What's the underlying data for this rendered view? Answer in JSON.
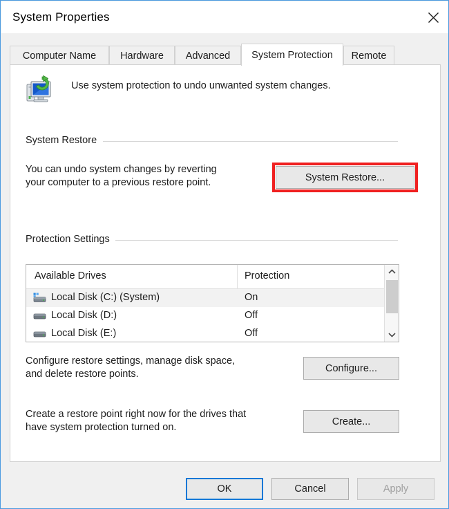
{
  "window": {
    "title": "System Properties",
    "close_icon": "close-icon",
    "border_color": "#4a9ae0"
  },
  "tabs": [
    {
      "label": "Computer Name",
      "active": false
    },
    {
      "label": "Hardware",
      "active": false
    },
    {
      "label": "Advanced",
      "active": false
    },
    {
      "label": "System Protection",
      "active": true
    },
    {
      "label": "Remote",
      "active": false
    }
  ],
  "intro": {
    "icon": "system-protection-icon",
    "text": "Use system protection to undo unwanted system changes."
  },
  "system_restore": {
    "group_label": "System Restore",
    "description": "You can undo system changes by reverting\nyour computer to a previous restore point.",
    "button_label": "System Restore...",
    "highlight_color": "#f02020"
  },
  "protection_settings": {
    "group_label": "Protection Settings",
    "columns": [
      "Available Drives",
      "Protection"
    ],
    "drives": [
      {
        "name": "Local Disk (C:) (System)",
        "protection": "On",
        "icon": "system-drive-icon",
        "selected": true
      },
      {
        "name": "Local Disk (D:)",
        "protection": "Off",
        "icon": "drive-icon",
        "selected": false
      },
      {
        "name": "Local Disk (E:)",
        "protection": "Off",
        "icon": "drive-icon",
        "selected": false
      }
    ],
    "scrollbar": {
      "up_icon": "chevron-up-icon",
      "down_icon": "chevron-down-icon"
    }
  },
  "configure": {
    "description": "Configure restore settings, manage disk space,\nand delete restore points.",
    "button_label": "Configure..."
  },
  "create": {
    "description": "Create a restore point right now for the drives that\nhave system protection turned on.",
    "button_label": "Create..."
  },
  "footer": {
    "ok_label": "OK",
    "cancel_label": "Cancel",
    "apply_label": "Apply",
    "apply_disabled": true
  }
}
